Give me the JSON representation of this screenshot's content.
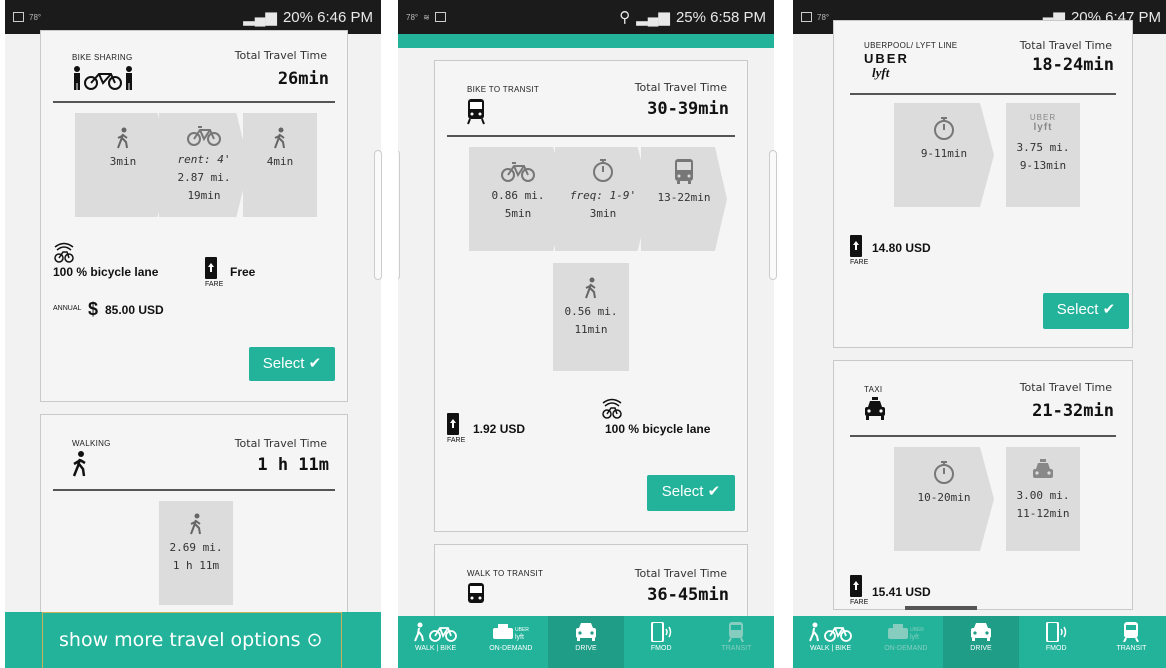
{
  "colors": {
    "accent": "#22b39a",
    "step_bg": "#dcdcdc",
    "status_bg": "#1b1b1b"
  },
  "screen1": {
    "status": {
      "temp": "78°",
      "time": "20%  6:46 PM"
    },
    "card1": {
      "mode": "BIKE SHARING",
      "ttt_label": "Total Travel Time",
      "ttt_value": "26min",
      "steps": [
        {
          "icon": "walk-icon",
          "lines": [
            "3min"
          ]
        },
        {
          "icon": "bike-icon",
          "italic": "rent: 4'",
          "lines": [
            "2.87 mi.",
            "19min"
          ]
        },
        {
          "icon": "walk-icon",
          "lines": [
            "4min"
          ]
        }
      ],
      "lane": "100 % bicycle lane",
      "fare": "Free",
      "fare_cap": "FARE",
      "annual_label": "ANNUAL",
      "annual_currency": "$",
      "annual_value": "85.00 USD",
      "select": "Select"
    },
    "card2": {
      "mode": "WALKING",
      "ttt_label": "Total Travel Time",
      "ttt_value": "1 h 11m",
      "step": {
        "icon": "walk-icon",
        "lines": [
          "2.69 mi.",
          "1 h 11m"
        ]
      }
    },
    "more": "show more travel options"
  },
  "screen2": {
    "status": {
      "temp": "78°",
      "time": "25%  6:58 PM"
    },
    "card1": {
      "mode": "BIKE TO TRANSIT",
      "ttt_label": "Total Travel Time",
      "ttt_value": "30-39min",
      "steps": [
        {
          "icon": "bike-icon",
          "lines": [
            "0.86 mi.",
            "5min"
          ]
        },
        {
          "icon": "stopwatch-icon",
          "italic": "freq: 1-9'",
          "lines": [
            "3min"
          ]
        },
        {
          "icon": "bus-icon",
          "lines": [
            "13-22min"
          ]
        },
        {
          "icon": "walk-icon",
          "lines": [
            "0.56 mi.",
            "11min"
          ]
        }
      ],
      "fare": "1.92 USD",
      "fare_cap": "FARE",
      "lane": "100 % bicycle lane",
      "select": "Select"
    },
    "card2": {
      "mode": "WALK TO TRANSIT",
      "ttt_label": "Total Travel Time",
      "ttt_value": "36-45min"
    },
    "nav": [
      "WALK | BIKE",
      "ON-DEMAND",
      "DRIVE",
      "FMOD",
      "TRANSIT"
    ]
  },
  "screen3": {
    "status": {
      "temp": "78°",
      "time": "20%  6:47 PM"
    },
    "card1": {
      "mode": "UBERPOOL/ LYFT LINE",
      "uber": "UBER",
      "lyft": "lyft",
      "ttt_label": "Total Travel Time",
      "ttt_value": "18-24min",
      "steps": [
        {
          "icon": "stopwatch-icon",
          "lines": [
            "9-11min"
          ]
        },
        {
          "icon": "uber-lyft-icon",
          "lines": [
            "3.75 mi.",
            "9-13min"
          ]
        }
      ],
      "fare": "14.80 USD",
      "fare_cap": "FARE",
      "select": "Select"
    },
    "card2": {
      "mode": "TAXI",
      "ttt_label": "Total Travel Time",
      "ttt_value": "21-32min",
      "steps": [
        {
          "icon": "stopwatch-icon",
          "lines": [
            "10-20min"
          ]
        },
        {
          "icon": "taxi-icon",
          "lines": [
            "3.00 mi.",
            "11-12min"
          ]
        }
      ],
      "fare": "15.41 USD",
      "fare_cap": "FARE"
    },
    "nav": [
      "WALK | BIKE",
      "ON-DEMAND",
      "DRIVE",
      "FMOD",
      "TRANSIT"
    ]
  }
}
